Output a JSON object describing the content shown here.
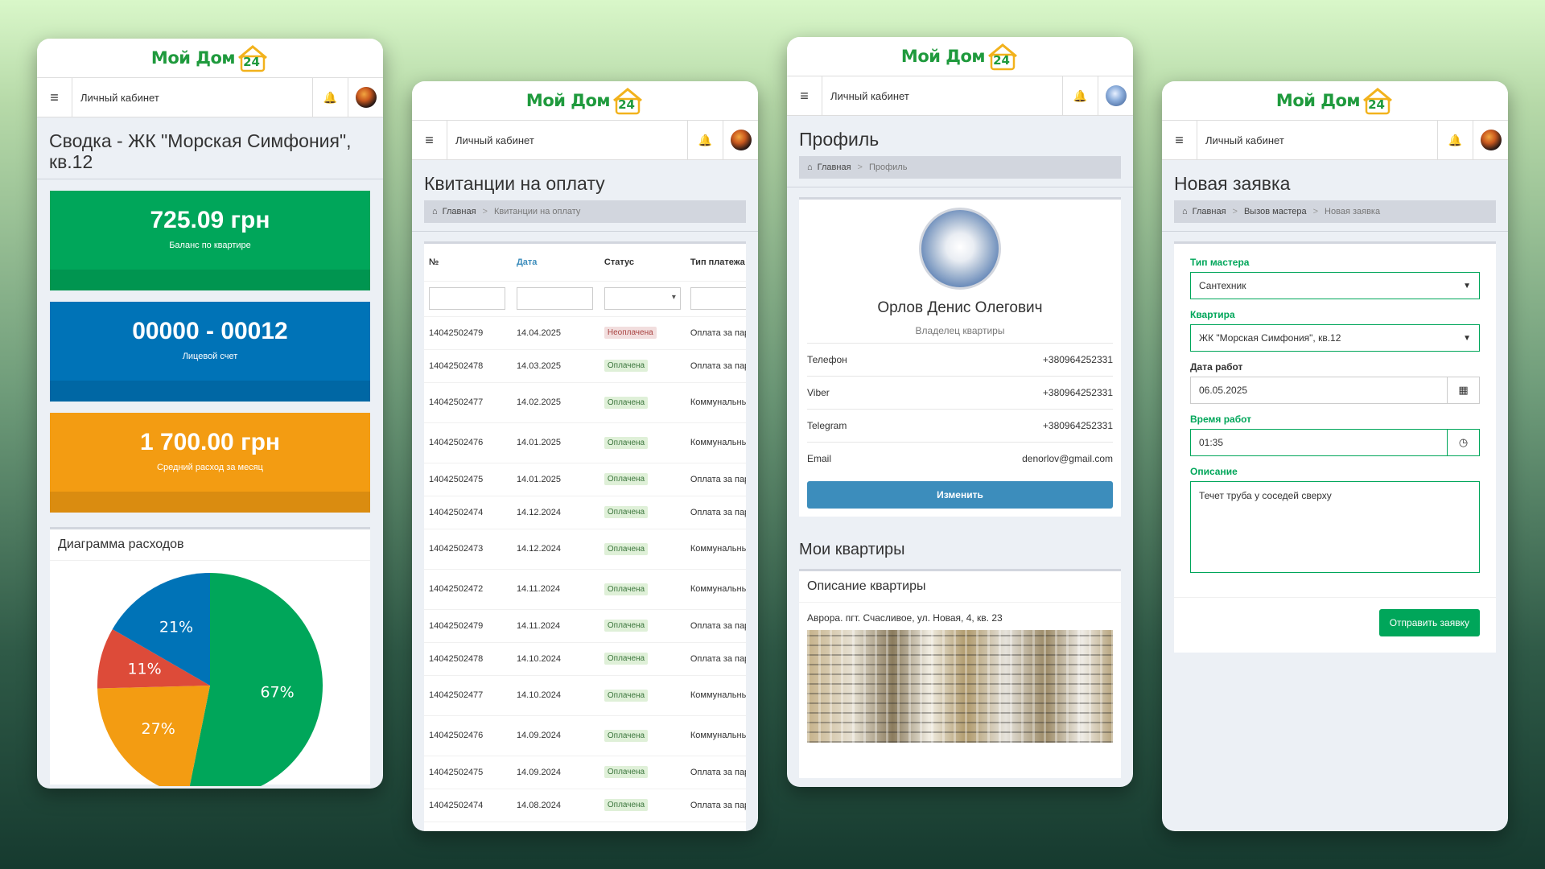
{
  "brand": {
    "logo_text": "Мой Дом",
    "logo_number": "24",
    "brand_color": "#1f9a3d"
  },
  "navbar": {
    "title": "Личный кабинет",
    "menu_icon": "bars-icon",
    "bell_icon": "bell-icon"
  },
  "screen1": {
    "title": "Сводка - ЖК \"Морская Симфония\", кв.12",
    "tiles": [
      {
        "value": "725.09 грн",
        "caption": "Баланс по квартире",
        "color": "#00a65a"
      },
      {
        "value": "00000 - 00012",
        "caption": "Лицевой счет",
        "color": "#0073b7"
      },
      {
        "value": "1 700.00 грн",
        "caption": "Средний расход за месяц",
        "color": "#f39c12"
      }
    ],
    "chart_box_title": "Диаграмма расходов"
  },
  "chart_data": {
    "type": "pie",
    "title": "Диаграмма расходов",
    "slices": [
      {
        "label": "67%",
        "value": 67,
        "color": "#00a65a"
      },
      {
        "label": "27%",
        "value": 27,
        "color": "#f39c12"
      },
      {
        "label": "11%",
        "value": 11,
        "color": "#dd4b39"
      },
      {
        "label": "21%",
        "value": 21,
        "color": "#0073b7"
      }
    ]
  },
  "screen2": {
    "title": "Квитанции на оплату",
    "breadcrumb": {
      "home": "Главная",
      "current": "Квитанции на оплату"
    },
    "columns": [
      "№",
      "Дата",
      "Статус",
      "Тип платежа"
    ],
    "rows": [
      {
        "num": "14042502479",
        "date": "14.04.2025",
        "status": "Неоплачена",
        "paid": false,
        "type": "Оплата за парко"
      },
      {
        "num": "14042502478",
        "date": "14.03.2025",
        "status": "Оплачена",
        "paid": true,
        "type": "Оплата за парко"
      },
      {
        "num": "14042502477",
        "date": "14.02.2025",
        "status": "Оплачена",
        "paid": true,
        "type": "Коммунальный платёж"
      },
      {
        "num": "14042502476",
        "date": "14.01.2025",
        "status": "Оплачена",
        "paid": true,
        "type": "Коммунальный платёж"
      },
      {
        "num": "14042502475",
        "date": "14.01.2025",
        "status": "Оплачена",
        "paid": true,
        "type": "Оплата за парко"
      },
      {
        "num": "14042502474",
        "date": "14.12.2024",
        "status": "Оплачена",
        "paid": true,
        "type": "Оплата за парко"
      },
      {
        "num": "14042502473",
        "date": "14.12.2024",
        "status": "Оплачена",
        "paid": true,
        "type": "Коммунальный платёж"
      },
      {
        "num": "14042502472",
        "date": "14.11.2024",
        "status": "Оплачена",
        "paid": true,
        "type": "Коммунальный платёж"
      },
      {
        "num": "14042502479",
        "date": "14.11.2024",
        "status": "Оплачена",
        "paid": true,
        "type": "Оплата за парко"
      },
      {
        "num": "14042502478",
        "date": "14.10.2024",
        "status": "Оплачена",
        "paid": true,
        "type": "Оплата за парко"
      },
      {
        "num": "14042502477",
        "date": "14.10.2024",
        "status": "Оплачена",
        "paid": true,
        "type": "Коммунальный платёж"
      },
      {
        "num": "14042502476",
        "date": "14.09.2024",
        "status": "Оплачена",
        "paid": true,
        "type": "Коммунальный платёж"
      },
      {
        "num": "14042502475",
        "date": "14.09.2024",
        "status": "Оплачена",
        "paid": true,
        "type": "Оплата за парко"
      },
      {
        "num": "14042502474",
        "date": "14.08.2024",
        "status": "Оплачена",
        "paid": true,
        "type": "Оплата за парко"
      }
    ]
  },
  "screen3": {
    "title": "Профиль",
    "breadcrumb": {
      "home": "Главная",
      "current": "Профиль"
    },
    "name": "Орлов Денис Олегович",
    "role": "Владелец квартиры",
    "fields": [
      {
        "label": "Телефон",
        "value": "+380964252331"
      },
      {
        "label": "Viber",
        "value": "+380964252331"
      },
      {
        "label": "Telegram",
        "value": "+380964252331"
      },
      {
        "label": "Email",
        "value": "denorlov@gmail.com"
      }
    ],
    "edit_label": "Изменить",
    "apartments_title": "Мои квартиры",
    "apartment_box_title": "Описание квартиры",
    "apartment_address": "Аврора. пгт. Счасливое, ул. Новая, 4, кв. 23"
  },
  "screen4": {
    "title": "Новая заявка",
    "breadcrumb": {
      "home": "Главная",
      "middle": "Вызов мастера",
      "current": "Новая заявка"
    },
    "master_type_label": "Тип мастера",
    "master_type_value": "Сантехник",
    "apartment_label": "Квартира",
    "apartment_value": "ЖК \"Морская Симфония\", кв.12",
    "date_label": "Дата работ",
    "date_value": "06.05.2025",
    "time_label": "Время работ",
    "time_value": "01:35",
    "description_label": "Описание",
    "description_value": "Течет труба у соседей сверху",
    "submit_label": "Отправить заявку"
  }
}
